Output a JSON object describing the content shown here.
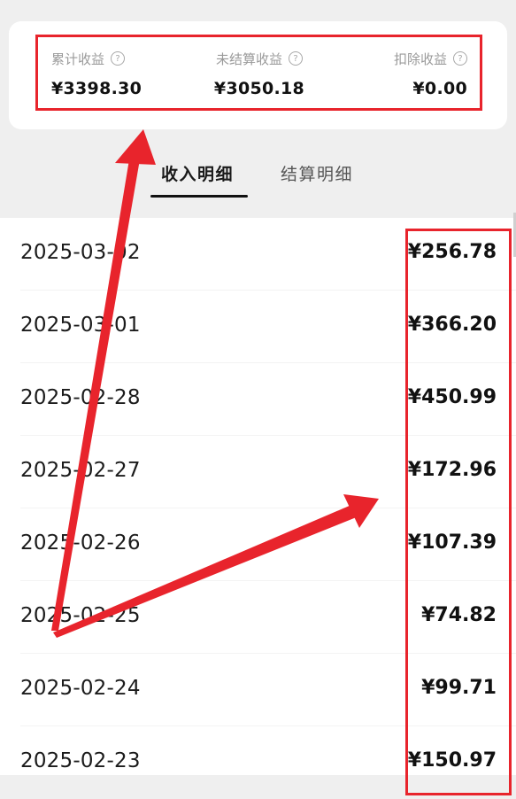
{
  "summary": {
    "items": [
      {
        "label": "累计收益",
        "value": "¥3398.30"
      },
      {
        "label": "未结算收益",
        "value": "¥3050.18"
      },
      {
        "label": "扣除收益",
        "value": "¥0.00"
      }
    ],
    "help_glyph": "?"
  },
  "tabs": [
    {
      "label": "收入明细",
      "active": true
    },
    {
      "label": "结算明细",
      "active": false
    }
  ],
  "records": [
    {
      "date": "2025-03-02",
      "amount": "¥256.78"
    },
    {
      "date": "2025-03-01",
      "amount": "¥366.20"
    },
    {
      "date": "2025-02-28",
      "amount": "¥450.99"
    },
    {
      "date": "2025-02-27",
      "amount": "¥172.96"
    },
    {
      "date": "2025-02-26",
      "amount": "¥107.39"
    },
    {
      "date": "2025-02-25",
      "amount": "¥74.82"
    },
    {
      "date": "2025-02-24",
      "amount": "¥99.71"
    },
    {
      "date": "2025-02-23",
      "amount": "¥150.97"
    }
  ],
  "colors": {
    "annotation": "#e8242c",
    "background": "#efefef"
  }
}
